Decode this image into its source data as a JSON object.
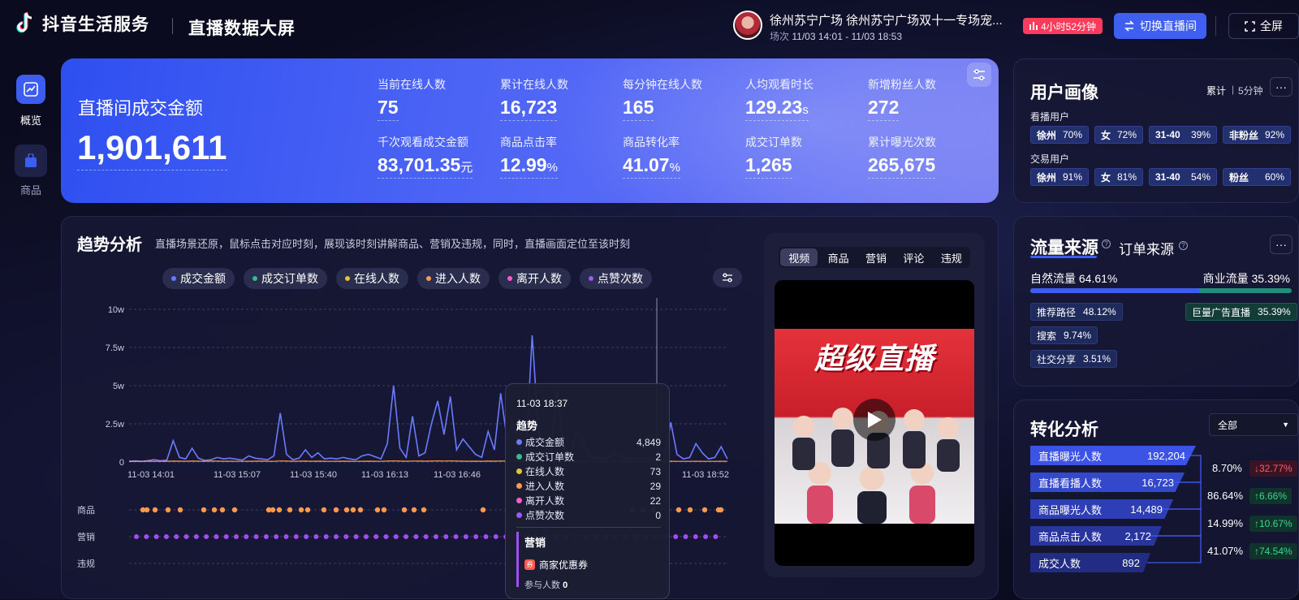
{
  "header": {
    "brand": "抖音生活服务",
    "screen_title": "直播数据大屏",
    "room_name": "徐州苏宁广场 徐州苏宁广场双十一专场宠...",
    "session_label": "场次",
    "session_time": "11/03 14:01 - 11/03 18:53",
    "live_duration": "4小时52分钟",
    "switch_label": "切换直播间",
    "fullscreen_label": "全屏"
  },
  "sidebar": {
    "items": [
      {
        "label": "概览",
        "icon": "trend-chart-icon",
        "active": true
      },
      {
        "label": "商品",
        "icon": "shopping-bag-icon",
        "active": false
      }
    ]
  },
  "hero": {
    "title": "直播间成交金额",
    "value": "1,901,611",
    "metrics": [
      {
        "label": "当前在线人数",
        "value": "75",
        "unit": ""
      },
      {
        "label": "累计在线人数",
        "value": "16,723",
        "unit": ""
      },
      {
        "label": "每分钟在线人数",
        "value": "165",
        "unit": ""
      },
      {
        "label": "人均观看时长",
        "value": "129.23",
        "unit": "s"
      },
      {
        "label": "新增粉丝人数",
        "value": "272",
        "unit": ""
      },
      {
        "label": "千次观看成交金额",
        "value": "83,701.35",
        "unit": "元"
      },
      {
        "label": "商品点击率",
        "value": "12.99",
        "unit": "%"
      },
      {
        "label": "商品转化率",
        "value": "41.07",
        "unit": "%"
      },
      {
        "label": "成交订单数",
        "value": "1,265",
        "unit": ""
      },
      {
        "label": "累计曝光次数",
        "value": "265,675",
        "unit": ""
      }
    ]
  },
  "trend": {
    "title": "趋势分析",
    "description": "直播场景还原，鼠标点击对应时刻，展现该时刻讲解商品、营销及违规，同时，直播画面定位至该时刻",
    "legend": [
      {
        "label": "成交金额",
        "color": "#6a7bff"
      },
      {
        "label": "成交订单数",
        "color": "#2fbf8a"
      },
      {
        "label": "在线人数",
        "color": "#e6c230"
      },
      {
        "label": "进入人数",
        "color": "#ff9a4d"
      },
      {
        "label": "离开人数",
        "color": "#ff5acd"
      },
      {
        "label": "点赞次数",
        "color": "#9b59f6"
      }
    ],
    "row_labels": [
      "商品",
      "营销",
      "违规"
    ],
    "video_tabs": [
      "视频",
      "商品",
      "营销",
      "评论",
      "违规"
    ],
    "video_title": "超级直播"
  },
  "chart_data": {
    "type": "line",
    "ylabel": "",
    "y_ticks": [
      "0",
      "2.5w",
      "5w",
      "7.5w",
      "10w"
    ],
    "ylim": [
      0,
      100000
    ],
    "x_ticks": [
      "11-03 14:01",
      "11-03 15:07",
      "11-03 15:40",
      "11-03 16:13",
      "11-03 16:46",
      "11-03 18:52"
    ],
    "series": [
      {
        "name": "成交金额",
        "values": [
          500,
          700,
          400,
          900,
          1500,
          800,
          1200,
          14000,
          3000,
          2000,
          9000,
          2500,
          1000,
          1500,
          3000,
          2000,
          2500,
          1800,
          1200,
          4000,
          2500,
          2000,
          1500,
          4000,
          32000,
          5000,
          1500,
          2500,
          8000,
          3000,
          6000,
          2000,
          2500,
          2000,
          3000,
          2000,
          1500,
          4000,
          5000,
          3500,
          2000,
          12000,
          50000,
          9000,
          3000,
          30000,
          4000,
          6000,
          25000,
          40000,
          18000,
          43000,
          8000,
          15000,
          10000,
          5000,
          3000,
          20000,
          8000,
          45000,
          15000,
          25000,
          10000,
          5000,
          83000,
          20000,
          10000,
          5000,
          47000,
          10000,
          5000,
          20000,
          14000,
          4000,
          2500,
          3000,
          2000,
          6000,
          4000,
          1500,
          2500,
          1800,
          3000,
          1200,
          4000,
          2000,
          26000,
          5000,
          2000,
          3000,
          12000,
          6000,
          2000,
          3000,
          10000,
          2000
        ]
      },
      {
        "name": "进入人数",
        "values": [
          300,
          400,
          350,
          500,
          450,
          400,
          500,
          600,
          550,
          500,
          600,
          550,
          500,
          600,
          550,
          500,
          500,
          450,
          400,
          500,
          550,
          600,
          500,
          450,
          700,
          600,
          500,
          550,
          600,
          500,
          550,
          500,
          450,
          500,
          550,
          500,
          450,
          500,
          550,
          500,
          450,
          600,
          700,
          600,
          500,
          650,
          600,
          550,
          600,
          700,
          650,
          700,
          600,
          550,
          500,
          550,
          500,
          600,
          550,
          650,
          600,
          550,
          500,
          450,
          700,
          600,
          550,
          500,
          650,
          550,
          500,
          600,
          550,
          500,
          450,
          500,
          450,
          500,
          450,
          400,
          450,
          400,
          450,
          400,
          450,
          400,
          500,
          450,
          400,
          450,
          500,
          450,
          400,
          450,
          500,
          400
        ]
      }
    ]
  },
  "tooltip": {
    "time": "11-03 18:37",
    "section": "趋势",
    "rows": [
      {
        "label": "成交金额",
        "value": "4,849",
        "color": "#6a7bff"
      },
      {
        "label": "成交订单数",
        "value": "2",
        "color": "#2fbf8a"
      },
      {
        "label": "在线人数",
        "value": "73",
        "color": "#e6c230"
      },
      {
        "label": "进入人数",
        "value": "29",
        "color": "#ff9a4d"
      },
      {
        "label": "离开人数",
        "value": "22",
        "color": "#ff5acd"
      },
      {
        "label": "点赞次数",
        "value": "0",
        "color": "#9b59f6"
      }
    ],
    "marketing_title": "营销",
    "coupon_label": "商家优惠券",
    "participants_label": "参与人数",
    "participants_value": "0"
  },
  "user_profile": {
    "title": "用户画像",
    "toggle_cumulative": "累计",
    "toggle_5min": "5分钟",
    "viewers_label": "看播用户",
    "viewers": [
      {
        "name": "徐州",
        "pct": "70%"
      },
      {
        "name": "女",
        "pct": "72%"
      },
      {
        "name": "31-40",
        "pct": "39%"
      },
      {
        "name": "非粉丝",
        "pct": "92%"
      }
    ],
    "buyers_label": "交易用户",
    "buyers": [
      {
        "name": "徐州",
        "pct": "91%"
      },
      {
        "name": "女",
        "pct": "81%"
      },
      {
        "name": "31-40",
        "pct": "54%"
      },
      {
        "name": "粉丝",
        "pct": "60%"
      }
    ]
  },
  "traffic": {
    "title": "流量来源",
    "alt_title": "订单来源",
    "natural_label": "自然流量 64.61%",
    "natural_fraction": 0.6461,
    "paid_label": "商业流量 35.39%",
    "natural_items": [
      {
        "name": "推荐路径",
        "pct": "48.12%"
      },
      {
        "name": "搜索",
        "pct": "9.74%"
      },
      {
        "name": "社交分享",
        "pct": "3.51%"
      }
    ],
    "paid_items": [
      {
        "name": "巨量广告直播",
        "pct": "35.39%"
      }
    ]
  },
  "conversion": {
    "title": "转化分析",
    "filter": "全部",
    "steps": [
      {
        "label": "直播曝光人数",
        "value": "192,204"
      },
      {
        "label": "直播看播人数",
        "value": "16,723"
      },
      {
        "label": "商品曝光人数",
        "value": "14,489"
      },
      {
        "label": "商品点击人数",
        "value": "2,172"
      },
      {
        "label": "成交人数",
        "value": "892"
      }
    ],
    "rates": [
      {
        "rate": "8.70%",
        "change": "↓32.77%",
        "dir": "down"
      },
      {
        "rate": "86.64%",
        "change": "↑6.66%",
        "dir": "up"
      },
      {
        "rate": "14.99%",
        "change": "↑10.67%",
        "dir": "up"
      },
      {
        "rate": "41.07%",
        "change": "↑74.54%",
        "dir": "up"
      }
    ]
  }
}
